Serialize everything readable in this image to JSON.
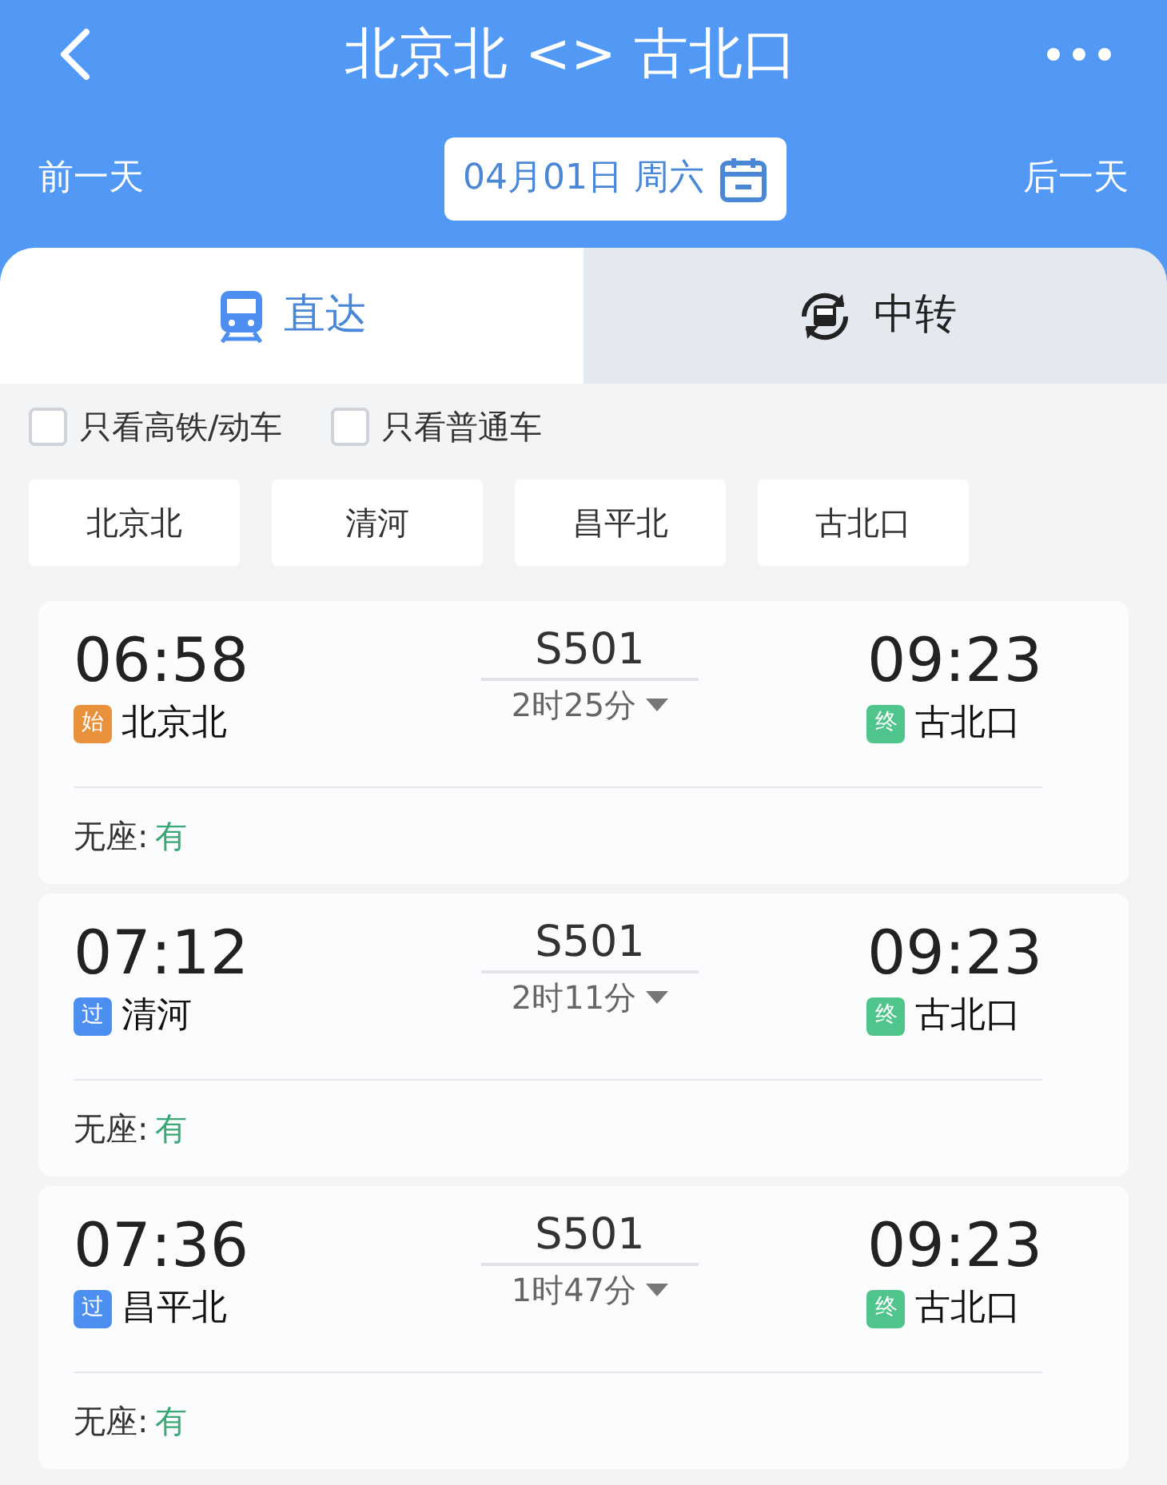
{
  "header": {
    "title": "北京北 <> 古北口",
    "prev_day": "前一天",
    "date": "04月01日 周六",
    "next_day": "后一天"
  },
  "tabs": [
    {
      "label": "直达",
      "kind": "direct",
      "selected": true
    },
    {
      "label": "中转",
      "kind": "transfer",
      "selected": false
    }
  ],
  "filters": [
    {
      "label": "只看高铁/动车",
      "checked": false
    },
    {
      "label": "只看普通车",
      "checked": false
    }
  ],
  "stations": [
    "北京北",
    "清河",
    "昌平北",
    "古北口"
  ],
  "trains": [
    {
      "depart_time": "06:58",
      "depart_badge": {
        "text": "始",
        "color": "#e9913b"
      },
      "depart_station": "北京北",
      "train_no": "S501",
      "duration": "2时25分",
      "arrive_time": "09:23",
      "arrive_badge": {
        "text": "终",
        "color": "#4fc48b"
      },
      "arrive_station": "古北口",
      "seat_label": "无座:",
      "seat_status": "有"
    },
    {
      "depart_time": "07:12",
      "depart_badge": {
        "text": "过",
        "color": "#4d8ff0"
      },
      "depart_station": "清河",
      "train_no": "S501",
      "duration": "2时11分",
      "arrive_time": "09:23",
      "arrive_badge": {
        "text": "终",
        "color": "#4fc48b"
      },
      "arrive_station": "古北口",
      "seat_label": "无座:",
      "seat_status": "有"
    },
    {
      "depart_time": "07:36",
      "depart_badge": {
        "text": "过",
        "color": "#4d8ff0"
      },
      "depart_station": "昌平北",
      "train_no": "S501",
      "duration": "1时47分",
      "arrive_time": "09:23",
      "arrive_badge": {
        "text": "终",
        "color": "#4fc48b"
      },
      "arrive_station": "古北口",
      "seat_label": "无座:",
      "seat_status": "有"
    }
  ]
}
